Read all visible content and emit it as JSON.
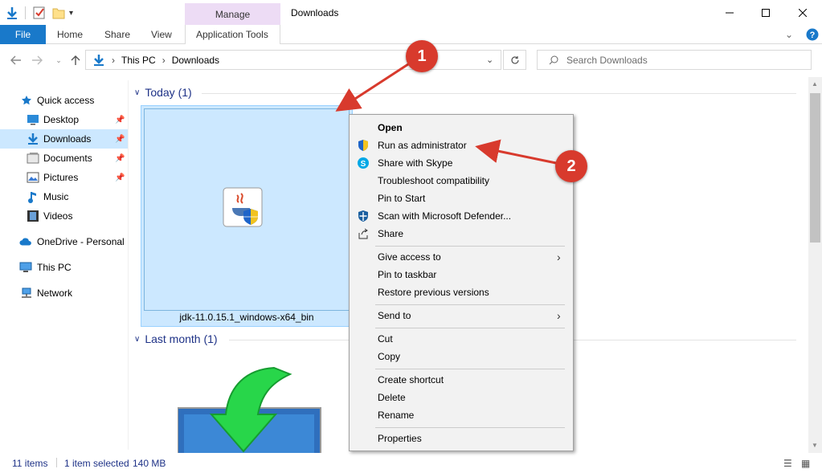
{
  "window": {
    "title": "Downloads",
    "context_tab_group": "Manage"
  },
  "ribbon": {
    "tabs": [
      "File",
      "Home",
      "Share",
      "View",
      "Application Tools"
    ]
  },
  "address": {
    "crumbs": [
      "This PC",
      "Downloads"
    ],
    "search_placeholder": "Search Downloads"
  },
  "nav": {
    "items": [
      {
        "label": "Quick access"
      },
      {
        "label": "Desktop"
      },
      {
        "label": "Downloads"
      },
      {
        "label": "Documents"
      },
      {
        "label": "Pictures"
      },
      {
        "label": "Music"
      },
      {
        "label": "Videos"
      },
      {
        "label": "OneDrive - Personal"
      },
      {
        "label": "This PC"
      },
      {
        "label": "Network"
      }
    ]
  },
  "content": {
    "groups": [
      {
        "label": "Today (1)"
      },
      {
        "label": "Last month (1)"
      }
    ],
    "selected_file": "jdk-11.0.15.1_windows-x64_bin"
  },
  "status": {
    "item_count": "11 items",
    "selection": "1 item selected",
    "size": "140 MB"
  },
  "context_menu": {
    "items": [
      "Open",
      "Run as administrator",
      "Share with Skype",
      "Troubleshoot compatibility",
      "Pin to Start",
      "Scan with Microsoft Defender...",
      "Share",
      "Give access to",
      "Pin to taskbar",
      "Restore previous versions",
      "Send to",
      "Cut",
      "Copy",
      "Create shortcut",
      "Delete",
      "Rename",
      "Properties"
    ]
  },
  "annotations": {
    "badge1": "1",
    "badge2": "2"
  },
  "colors": {
    "accent": "#1979ca",
    "selection": "#cce8ff",
    "manage": "#eddcf5",
    "badge": "#d83a2d"
  }
}
